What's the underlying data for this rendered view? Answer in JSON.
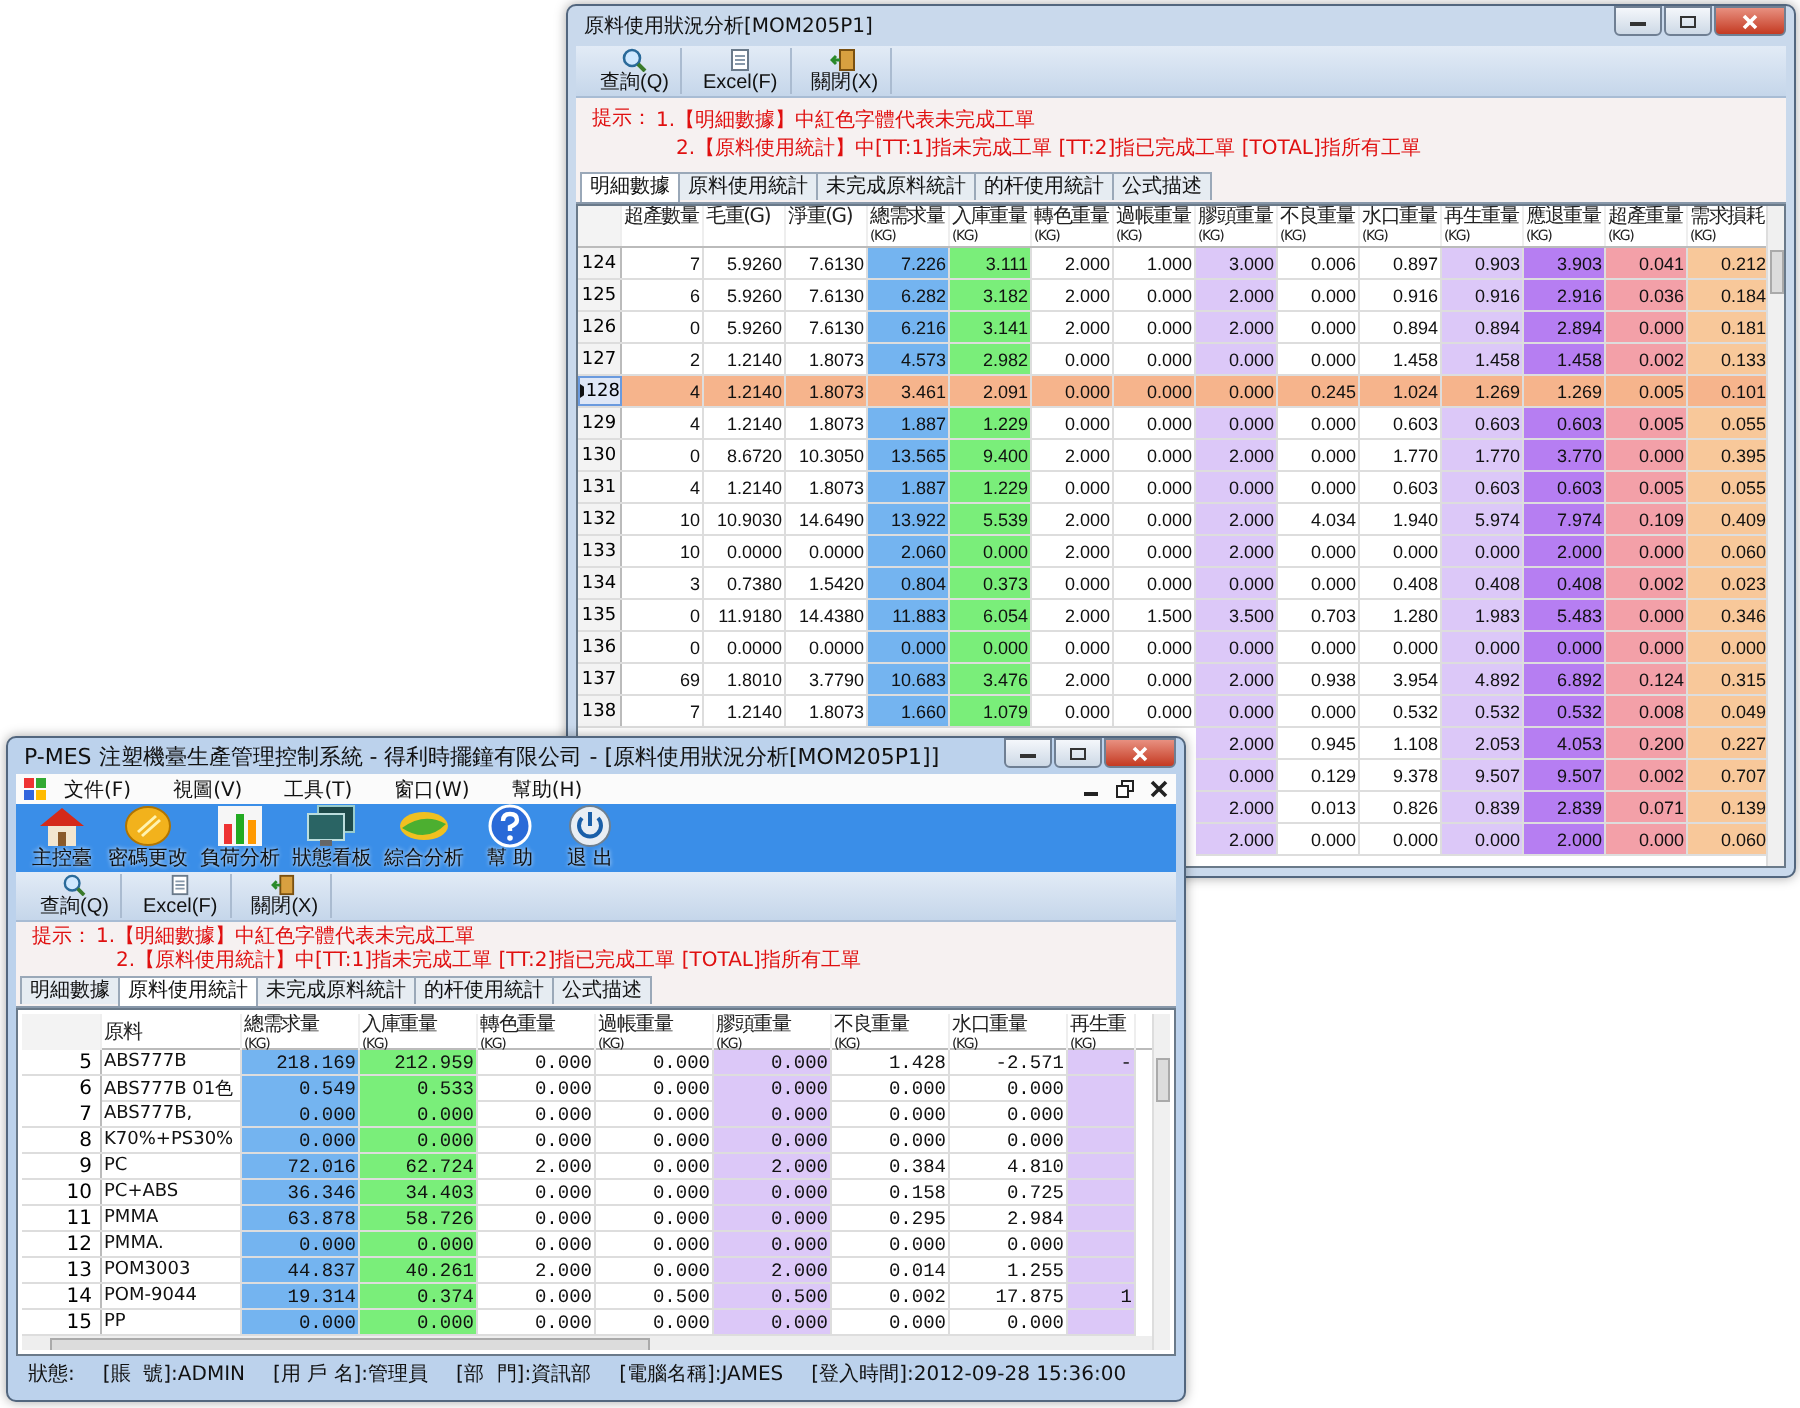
{
  "windows": [
    {
      "title": "原料使用狀況分析[MOM205P1]",
      "toolbar": [
        {
          "label": "查詢(Q)",
          "kind": "query"
        },
        {
          "label": "Excel(F)",
          "kind": "excel"
        },
        {
          "label": "關閉(X)",
          "kind": "close"
        }
      ],
      "hint": {
        "label": "提示：",
        "lines": [
          "1.【明細數據】中紅色字體代表未完成工單",
          "2.【原料使用統計】中[TT:1]指未完成工單 [TT:2]指已完成工單 [TOTAL]指所有工單"
        ]
      },
      "tabs": [
        {
          "label": "明細數據",
          "selected": true
        },
        {
          "label": "原料使用統計",
          "selected": false
        },
        {
          "label": "未完成原料統計",
          "selected": false
        },
        {
          "label": "的杆使用統計",
          "selected": false
        },
        {
          "label": "公式描述",
          "selected": false
        }
      ],
      "table": {
        "columns": [
          {
            "label": "超產數量",
            "kind": "number"
          },
          {
            "label": "毛重(G)",
            "kind": "number"
          },
          {
            "label": "淨重(G)",
            "kind": "number"
          },
          {
            "label": "總需求量",
            "unit": "(KG)",
            "kind": "number",
            "color": "#74b4f0"
          },
          {
            "label": "入庫重量",
            "unit": "(KG)",
            "kind": "number",
            "color": "#7aee7a"
          },
          {
            "label": "轉色重量",
            "unit": "(KG)",
            "kind": "number"
          },
          {
            "label": "過帳重量",
            "unit": "(KG)",
            "kind": "number"
          },
          {
            "label": "膠頭重量",
            "unit": "(KG)",
            "kind": "number",
            "color": "#dcc8f8"
          },
          {
            "label": "不良重量",
            "unit": "(KG)",
            "kind": "number"
          },
          {
            "label": "水口重量",
            "unit": "(KG)",
            "kind": "number"
          },
          {
            "label": "再生重量",
            "unit": "(KG)",
            "kind": "number",
            "color": "#dcc8f8"
          },
          {
            "label": "應退重量",
            "unit": "(KG)",
            "kind": "number",
            "color": "#b67ef2"
          },
          {
            "label": "超產重量",
            "unit": "(KG)",
            "kind": "number",
            "color": "#f3a0a8"
          },
          {
            "label": "需求損耗",
            "unit": "(KG)",
            "kind": "number",
            "color": "#f8c89a"
          }
        ],
        "rows": [
          {
            "number": "124",
            "selected": false,
            "cells": [
              "7",
              "5.9260",
              "7.6130",
              "7.226",
              "3.111",
              "2.000",
              "1.000",
              "3.000",
              "0.006",
              "0.897",
              "0.903",
              "3.903",
              "0.041",
              "0.212"
            ]
          },
          {
            "number": "125",
            "selected": false,
            "cells": [
              "6",
              "5.9260",
              "7.6130",
              "6.282",
              "3.182",
              "2.000",
              "0.000",
              "2.000",
              "0.000",
              "0.916",
              "0.916",
              "2.916",
              "0.036",
              "0.184"
            ]
          },
          {
            "number": "126",
            "selected": false,
            "cells": [
              "0",
              "5.9260",
              "7.6130",
              "6.216",
              "3.141",
              "2.000",
              "0.000",
              "2.000",
              "0.000",
              "0.894",
              "0.894",
              "2.894",
              "0.000",
              "0.181"
            ]
          },
          {
            "number": "127",
            "selected": false,
            "cells": [
              "2",
              "1.2140",
              "1.8073",
              "4.573",
              "2.982",
              "0.000",
              "0.000",
              "0.000",
              "0.000",
              "1.458",
              "1.458",
              "1.458",
              "0.002",
              "0.133"
            ]
          },
          {
            "number": "128",
            "selected": true,
            "cells": [
              "4",
              "1.2140",
              "1.8073",
              "3.461",
              "2.091",
              "0.000",
              "0.000",
              "0.000",
              "0.245",
              "1.024",
              "1.269",
              "1.269",
              "0.005",
              "0.101"
            ]
          },
          {
            "number": "129",
            "selected": false,
            "cells": [
              "4",
              "1.2140",
              "1.8073",
              "1.887",
              "1.229",
              "0.000",
              "0.000",
              "0.000",
              "0.000",
              "0.603",
              "0.603",
              "0.603",
              "0.005",
              "0.055"
            ]
          },
          {
            "number": "130",
            "selected": false,
            "cells": [
              "0",
              "8.6720",
              "10.3050",
              "13.565",
              "9.400",
              "2.000",
              "0.000",
              "2.000",
              "0.000",
              "1.770",
              "1.770",
              "3.770",
              "0.000",
              "0.395"
            ]
          },
          {
            "number": "131",
            "selected": false,
            "cells": [
              "4",
              "1.2140",
              "1.8073",
              "1.887",
              "1.229",
              "0.000",
              "0.000",
              "0.000",
              "0.000",
              "0.603",
              "0.603",
              "0.603",
              "0.005",
              "0.055"
            ]
          },
          {
            "number": "132",
            "selected": false,
            "cells": [
              "10",
              "10.9030",
              "14.6490",
              "13.922",
              "5.539",
              "2.000",
              "0.000",
              "2.000",
              "4.034",
              "1.940",
              "5.974",
              "7.974",
              "0.109",
              "0.409"
            ]
          },
          {
            "number": "133",
            "selected": false,
            "cells": [
              "10",
              "0.0000",
              "0.0000",
              "2.060",
              "0.000",
              "2.000",
              "0.000",
              "2.000",
              "0.000",
              "0.000",
              "0.000",
              "2.000",
              "0.000",
              "0.060"
            ]
          },
          {
            "number": "134",
            "selected": false,
            "cells": [
              "3",
              "0.7380",
              "1.5420",
              "0.804",
              "0.373",
              "0.000",
              "0.000",
              "0.000",
              "0.000",
              "0.408",
              "0.408",
              "0.408",
              "0.002",
              "0.023"
            ]
          },
          {
            "number": "135",
            "selected": false,
            "cells": [
              "0",
              "11.9180",
              "14.4380",
              "11.883",
              "6.054",
              "2.000",
              "1.500",
              "3.500",
              "0.703",
              "1.280",
              "1.983",
              "5.483",
              "0.000",
              "0.346"
            ]
          },
          {
            "number": "136",
            "selected": false,
            "cells": [
              "0",
              "0.0000",
              "0.0000",
              "0.000",
              "0.000",
              "0.000",
              "0.000",
              "0.000",
              "0.000",
              "0.000",
              "0.000",
              "0.000",
              "0.000",
              "0.000"
            ]
          },
          {
            "number": "137",
            "selected": false,
            "cells": [
              "69",
              "1.8010",
              "3.7790",
              "10.683",
              "3.476",
              "2.000",
              "0.000",
              "2.000",
              "0.938",
              "3.954",
              "4.892",
              "6.892",
              "0.124",
              "0.315"
            ]
          },
          {
            "number": "138",
            "selected": false,
            "cells": [
              "7",
              "1.2140",
              "1.8073",
              "1.660",
              "1.079",
              "0.000",
              "0.000",
              "0.000",
              "0.000",
              "0.532",
              "0.532",
              "0.532",
              "0.008",
              "0.049"
            ]
          },
          {
            "selected": false,
            "cells": [
              null,
              null,
              null,
              null,
              null,
              null,
              null,
              "2.000",
              "0.945",
              "1.108",
              "2.053",
              "4.053",
              "0.200",
              "0.227"
            ]
          },
          {
            "selected": false,
            "cells": [
              null,
              null,
              null,
              null,
              null,
              null,
              null,
              "0.000",
              "0.129",
              "9.378",
              "9.507",
              "9.507",
              "0.002",
              "0.707"
            ]
          },
          {
            "selected": false,
            "cells": [
              null,
              null,
              null,
              null,
              null,
              null,
              null,
              "2.000",
              "0.013",
              "0.826",
              "0.839",
              "2.839",
              "0.071",
              "0.139"
            ]
          },
          {
            "selected": false,
            "cells": [
              null,
              null,
              null,
              null,
              null,
              null,
              null,
              "2.000",
              "0.000",
              "0.000",
              "0.000",
              "2.000",
              "0.000",
              "0.060"
            ]
          }
        ]
      }
    },
    {
      "title": "P-MES 注塑機臺生產管理控制系統 - 得利時擺鐘有限公司 - [原料使用狀況分析[MOM205P1]]",
      "menu": [
        "文件(F)",
        "視圖(V)",
        "工具(T)",
        "窗口(W)",
        "幫助(H)"
      ],
      "launcher": [
        {
          "label": "主控臺",
          "kind": "home"
        },
        {
          "label": "密碼更改",
          "kind": "password"
        },
        {
          "label": "負荷分析",
          "kind": "chart"
        },
        {
          "label": "狀態看板",
          "kind": "monitor"
        },
        {
          "label": "綜合分析",
          "kind": "analysis"
        },
        {
          "label": "幫 助",
          "kind": "help"
        },
        {
          "label": "退 出",
          "kind": "exit"
        }
      ],
      "toolbar": [
        {
          "label": "查詢(Q)",
          "kind": "query"
        },
        {
          "label": "Excel(F)",
          "kind": "excel"
        },
        {
          "label": "關閉(X)",
          "kind": "close"
        }
      ],
      "hint": {
        "label": "提示：",
        "lines": [
          "1.【明細數據】中紅色字體代表未完成工單",
          "2.【原料使用統計】中[TT:1]指未完成工單 [TT:2]指已完成工單 [TOTAL]指所有工單"
        ]
      },
      "tabs": [
        {
          "label": "明細數據",
          "selected": false
        },
        {
          "label": "原料使用統計",
          "selected": true
        },
        {
          "label": "未完成原料統計",
          "selected": false
        },
        {
          "label": "的杆使用統計",
          "selected": false
        },
        {
          "label": "公式描述",
          "selected": false
        }
      ],
      "table": {
        "columns": [
          {
            "label": "原料",
            "kind": "text"
          },
          {
            "label": "總需求量",
            "unit": "(KG)",
            "kind": "number",
            "color": "#74b4f0"
          },
          {
            "label": "入庫重量",
            "unit": "(KG)",
            "kind": "number",
            "color": "#7aee7a"
          },
          {
            "label": "轉色重量",
            "unit": "(KG)",
            "kind": "number"
          },
          {
            "label": "過帳重量",
            "unit": "(KG)",
            "kind": "number"
          },
          {
            "label": "膠頭重量",
            "unit": "(KG)",
            "kind": "number",
            "color": "#dcc8f8"
          },
          {
            "label": "不良重量",
            "unit": "(KG)",
            "kind": "number"
          },
          {
            "label": "水口重量",
            "unit": "(KG)",
            "kind": "number"
          },
          {
            "label": "再生重",
            "unit": "(KG)",
            "kind": "number",
            "color": "#dcc8f8"
          }
        ],
        "rows": [
          {
            "number": "5",
            "cells": [
              "ABS777B",
              "218.169",
              "212.959",
              "0.000",
              "0.000",
              "0.000",
              "1.428",
              "-2.571",
              "-"
            ]
          },
          {
            "number": "6",
            "cells": [
              "ABS777B 01色",
              "0.549",
              "0.533",
              "0.000",
              "0.000",
              "0.000",
              "0.000",
              "0.000",
              null
            ]
          },
          {
            "number": "7",
            "cells": [
              "ABS777B,",
              "0.000",
              "0.000",
              "0.000",
              "0.000",
              "0.000",
              "0.000",
              "0.000",
              null
            ]
          },
          {
            "number": "8",
            "cells": [
              "K70%+PS30%",
              "0.000",
              "0.000",
              "0.000",
              "0.000",
              "0.000",
              "0.000",
              "0.000",
              null
            ]
          },
          {
            "number": "9",
            "cells": [
              "PC",
              "72.016",
              "62.724",
              "2.000",
              "0.000",
              "2.000",
              "0.384",
              "4.810",
              null
            ]
          },
          {
            "number": "10",
            "cells": [
              "PC+ABS",
              "36.346",
              "34.403",
              "0.000",
              "0.000",
              "0.000",
              "0.158",
              "0.725",
              null
            ]
          },
          {
            "number": "11",
            "cells": [
              "PMMA",
              "63.878",
              "58.726",
              "0.000",
              "0.000",
              "0.000",
              "0.295",
              "2.984",
              null
            ]
          },
          {
            "number": "12",
            "cells": [
              "PMMA.",
              "0.000",
              "0.000",
              "0.000",
              "0.000",
              "0.000",
              "0.000",
              "0.000",
              null
            ]
          },
          {
            "number": "13",
            "cells": [
              "POM3003",
              "44.837",
              "40.261",
              "2.000",
              "0.000",
              "2.000",
              "0.014",
              "1.255",
              null
            ]
          },
          {
            "number": "14",
            "cells": [
              "POM-9044",
              "19.314",
              "0.374",
              "0.000",
              "0.500",
              "0.500",
              "0.002",
              "17.875",
              "1"
            ]
          },
          {
            "number": "15",
            "cells": [
              "PP",
              "0.000",
              "0.000",
              "0.000",
              "0.000",
              "0.000",
              "0.000",
              "0.000",
              null
            ]
          }
        ]
      },
      "status_bar": [
        "狀態:",
        "[賬  號]:ADMIN",
        "[用 戶 名]:管理員",
        "[部  門]:資訊部",
        "[電腦名稱]:JAMES",
        "[登入時間]:2012-09-28 15:36:00"
      ]
    }
  ]
}
